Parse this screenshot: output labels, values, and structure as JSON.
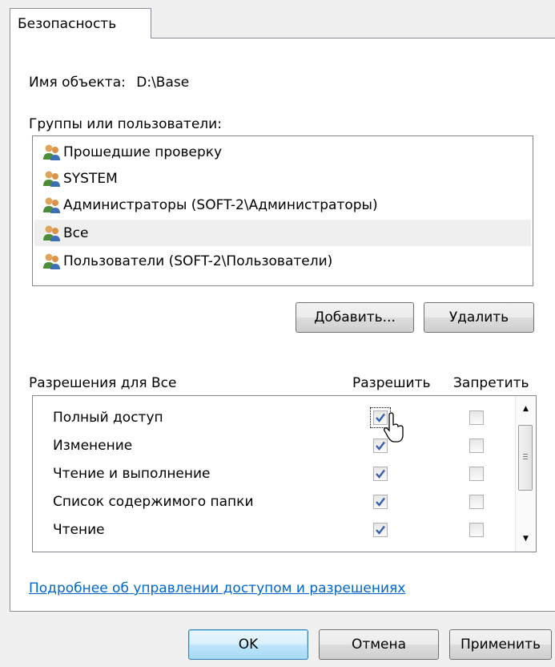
{
  "tab": {
    "label": "Безопасность"
  },
  "object": {
    "label": "Имя объекта:",
    "value": "D:\\Base"
  },
  "groups": {
    "label": "Группы или пользователи:",
    "items": [
      {
        "label": "Прошедшие проверку",
        "selected": false
      },
      {
        "label": "SYSTEM",
        "selected": false
      },
      {
        "label": "Администраторы (SOFT-2\\Администраторы)",
        "selected": false
      },
      {
        "label": "Все",
        "selected": true
      },
      {
        "label": "Пользователи (SOFT-2\\Пользователи)",
        "selected": false
      }
    ],
    "icon": "users-group-icon"
  },
  "buttons": {
    "add": "Добавить...",
    "remove": "Удалить"
  },
  "permissions": {
    "label": "Разрешения для Все",
    "allow_header": "Разрешить",
    "deny_header": "Запретить",
    "rows": [
      {
        "label": "Полный доступ",
        "allow": true,
        "deny": false,
        "focused": true
      },
      {
        "label": "Изменение",
        "allow": true,
        "deny": false
      },
      {
        "label": "Чтение и выполнение",
        "allow": true,
        "deny": false
      },
      {
        "label": "Список содержимого папки",
        "allow": true,
        "deny": false
      },
      {
        "label": "Чтение",
        "allow": true,
        "deny": false
      }
    ]
  },
  "link": {
    "label": "Подробнее об управлении доступом и разрешениях"
  },
  "dialog_buttons": {
    "ok": "OK",
    "cancel": "Отмена",
    "apply": "Применить"
  },
  "colors": {
    "link": "#0066cc",
    "check": "#3a5fa9",
    "default_button_border": "#3c7fb1"
  }
}
